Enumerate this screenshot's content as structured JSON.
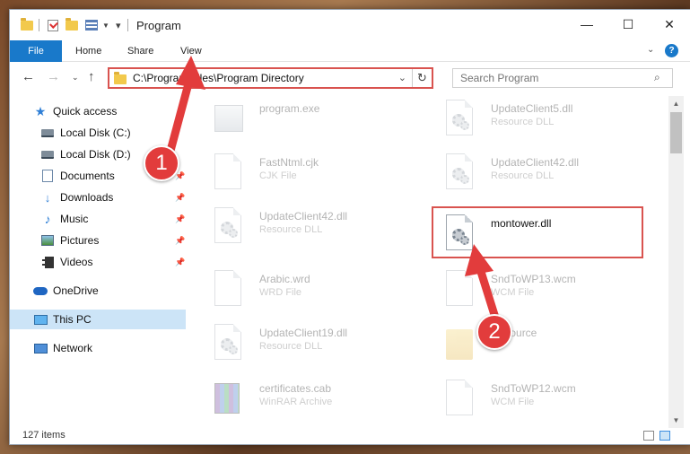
{
  "window": {
    "title": "Program"
  },
  "ribbon": {
    "tabs": [
      "File",
      "Home",
      "Share",
      "View"
    ]
  },
  "address": {
    "path": "C:\\Program Files\\Program Directory"
  },
  "search": {
    "placeholder": "Search Program"
  },
  "sidebar": {
    "items": [
      {
        "label": "Quick access",
        "icon": "star-icon"
      },
      {
        "label": "Local Disk (C:)",
        "icon": "drive-icon"
      },
      {
        "label": "Local Disk (D:)",
        "icon": "drive-icon"
      },
      {
        "label": "Documents",
        "icon": "documents-icon"
      },
      {
        "label": "Downloads",
        "icon": "download-icon"
      },
      {
        "label": "Music",
        "icon": "music-icon"
      },
      {
        "label": "Pictures",
        "icon": "pictures-icon"
      },
      {
        "label": "Videos",
        "icon": "videos-icon"
      },
      {
        "label": "OneDrive",
        "icon": "cloud-icon"
      },
      {
        "label": "This PC",
        "icon": "computer-icon"
      },
      {
        "label": "Network",
        "icon": "network-icon"
      }
    ]
  },
  "files": [
    {
      "name": "program.exe",
      "type": ""
    },
    {
      "name": "UpdateClient5.dll",
      "type": "Resource DLL"
    },
    {
      "name": "FastNtml.cjk",
      "type": "CJK File"
    },
    {
      "name": "UpdateClient42.dll",
      "type": "Resource DLL"
    },
    {
      "name": "UpdateClient42.dll",
      "type": "Resource DLL"
    },
    {
      "name": "montower.dll",
      "type": ""
    },
    {
      "name": "Arabic.wrd",
      "type": "WRD File"
    },
    {
      "name": "SndToWP13.wcm",
      "type": "WCM File"
    },
    {
      "name": "UpdateClient19.dll",
      "type": "Resource DLL"
    },
    {
      "name": "Resource",
      "type": ""
    },
    {
      "name": "certificates.cab",
      "type": "WinRAR Archive"
    },
    {
      "name": "SndToWP12.wcm",
      "type": "WCM File"
    }
  ],
  "status": {
    "count": "127 items"
  },
  "callouts": {
    "one": "1",
    "two": "2"
  },
  "colors": {
    "accent": "#1979ca",
    "highlight": "#d9534f",
    "callout": "#e23c3c"
  }
}
